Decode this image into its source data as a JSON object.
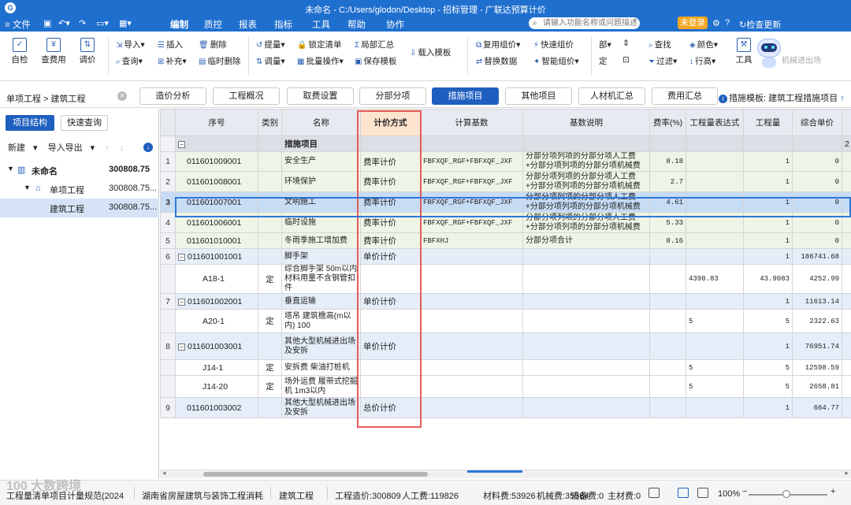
{
  "app": {
    "title": "未命名 - C:/Users/glodon/Desktop - 招标管理 - 广联达预算计价",
    "menu": [
      "文件",
      "编制",
      "质控",
      "报表",
      "指标",
      "工具",
      "帮助",
      "协作"
    ],
    "search_placeholder": "请输入功能名称或问题描述",
    "login": "未登录",
    "check_update": "检查更新"
  },
  "ribbon": {
    "big": [
      "自检",
      "查费用",
      "调价"
    ],
    "small": [
      [
        "导入",
        "查询"
      ],
      [
        "插入",
        "补充"
      ],
      [
        "删除",
        "临时删除"
      ],
      [
        "提量",
        "调量"
      ],
      [
        "锁定清单",
        "批量操作"
      ],
      [
        "局部汇总",
        "保存模板"
      ],
      [
        "载入模板"
      ],
      [
        "复用组价",
        "替换数据"
      ],
      [
        "快速组价",
        "智能组价"
      ],
      [
        "部",
        "定"
      ],
      [
        "查找",
        "过滤"
      ],
      [
        "颜色",
        "行高"
      ],
      [
        "工具"
      ]
    ],
    "machinery": "机械进出场"
  },
  "tabs": {
    "breadcrumb": "单项工程 > 建筑工程",
    "items": [
      "造价分析",
      "工程概况",
      "取费设置",
      "分部分项",
      "措施项目",
      "其他项目",
      "人材机汇总",
      "费用汇总"
    ],
    "active": "措施项目",
    "template": "措施模板: 建筑工程措施项目"
  },
  "sidebar": {
    "btn_structure": "项目结构",
    "btn_quick": "快速查询",
    "new": "新建",
    "import_export": "导入导出",
    "tree": [
      {
        "label": "未命名",
        "value": "300808.75"
      },
      {
        "label": "单项工程",
        "value": "300808.75..."
      },
      {
        "label": "建筑工程",
        "value": "300808.75..."
      }
    ]
  },
  "grid": {
    "headers": [
      "序号",
      "类别",
      "名称",
      "计价方式",
      "计算基数",
      "基数说明",
      "费率(%)",
      "工程量表达式",
      "工程量",
      "综合单价"
    ],
    "group": {
      "name": "措施项目",
      "extra": "2"
    },
    "rows": [
      {
        "idx": "1",
        "code": "011601009001",
        "type": "",
        "name": "安全生产",
        "method": "费率计价",
        "base": "FBFXQF_RGF+FBFXQF_JXF",
        "desc": "分部分项列项的分部分项人工费\n+分部分项列项的分部分项机械费",
        "rate": "8.18",
        "expr": "",
        "qty": "1",
        "price": "0"
      },
      {
        "idx": "2",
        "code": "011601008001",
        "type": "",
        "name": "环境保护",
        "method": "费率计价",
        "base": "FBFXQF_RGF+FBFXQF_JXF",
        "desc": "分部分项列项的分部分项人工费\n+分部分项列项的分部分项机械费",
        "rate": "2.7",
        "expr": "",
        "qty": "1",
        "price": "0"
      },
      {
        "idx": "3",
        "code": "011601007001",
        "type": "",
        "name": "文明施工",
        "method": "费率计价",
        "base": "FBFXQF_RGF+FBFXQF_JXF",
        "desc": "分部分项列项的分部分项人工费\n+分部分项列项的分部分项机械费",
        "rate": "4.61",
        "expr": "",
        "qty": "1",
        "price": "0"
      },
      {
        "idx": "4",
        "code": "011601006001",
        "type": "",
        "name": "临时设施",
        "method": "费率计价",
        "base": "FBFXQF_RGF+FBFXQF_JXF",
        "desc": "分部分项列项的分部分项人工费\n+分部分项列项的分部分项机械费",
        "rate": "5.33",
        "expr": "",
        "qty": "1",
        "price": "0"
      },
      {
        "idx": "5",
        "code": "011601010001",
        "type": "",
        "name": "冬雨季施工增加费",
        "method": "费率计价",
        "base": "FBFXHJ",
        "desc": "分部分项合计",
        "rate": "0.16",
        "expr": "",
        "qty": "1",
        "price": "0"
      },
      {
        "idx": "6",
        "code": "011601001001",
        "type": "",
        "name": "脚手架",
        "method": "单价计价",
        "base": "",
        "desc": "",
        "rate": "",
        "expr": "",
        "qty": "1",
        "price": "186741.68"
      },
      {
        "idx": "",
        "code": "A18-1",
        "type": "定",
        "name": "综合脚手架 50m以内\n材料用量不含钢管扣\n件",
        "method": "",
        "base": "",
        "desc": "",
        "rate": "",
        "expr": "4390.83",
        "qty": "43.9083",
        "price": "4252.99"
      },
      {
        "idx": "7",
        "code": "011601002001",
        "type": "",
        "name": "垂直运输",
        "method": "单价计价",
        "base": "",
        "desc": "",
        "rate": "",
        "expr": "",
        "qty": "1",
        "price": "11613.14"
      },
      {
        "idx": "",
        "code": "A20-1",
        "type": "定",
        "name": "塔吊 建筑檐高(m以\n内) 100",
        "method": "",
        "base": "",
        "desc": "",
        "rate": "",
        "expr": "5",
        "qty": "5",
        "price": "2322.63"
      },
      {
        "idx": "8",
        "code": "011601003001",
        "type": "",
        "name": "其他大型机械进出场\n及安拆",
        "method": "单价计价",
        "base": "",
        "desc": "",
        "rate": "",
        "expr": "",
        "qty": "1",
        "price": "76951.74"
      },
      {
        "idx": "",
        "code": "J14-1",
        "type": "定",
        "name": "安拆费 柴油打桩机",
        "method": "",
        "base": "",
        "desc": "",
        "rate": "",
        "expr": "5",
        "qty": "5",
        "price": "12598.59"
      },
      {
        "idx": "",
        "code": "J14-20",
        "type": "定",
        "name": "场外运费 履带式挖掘\n机 1m3以内",
        "method": "",
        "base": "",
        "desc": "",
        "rate": "",
        "expr": "5",
        "qty": "5",
        "price": "2658.81"
      },
      {
        "idx": "9",
        "code": "011601003002",
        "type": "",
        "name": "其他大型机械进出场\n及安拆",
        "method": "总价计价",
        "base": "",
        "desc": "",
        "rate": "",
        "expr": "",
        "qty": "1",
        "price": "664.77"
      }
    ]
  },
  "status": {
    "std": "工程量清单项目计量规范(2024",
    "region": "湖南省房屋建筑与装饰工程消耗",
    "project": "建筑工程",
    "total": "工程造价:300809",
    "labor": "人工费:119826",
    "material": "材料费:53926",
    "machine": "机械费:35584",
    "equip": "设备费:0",
    "main_mat": "主材费:0",
    "zoom": "100%"
  },
  "watermark": "100 大数跨境"
}
